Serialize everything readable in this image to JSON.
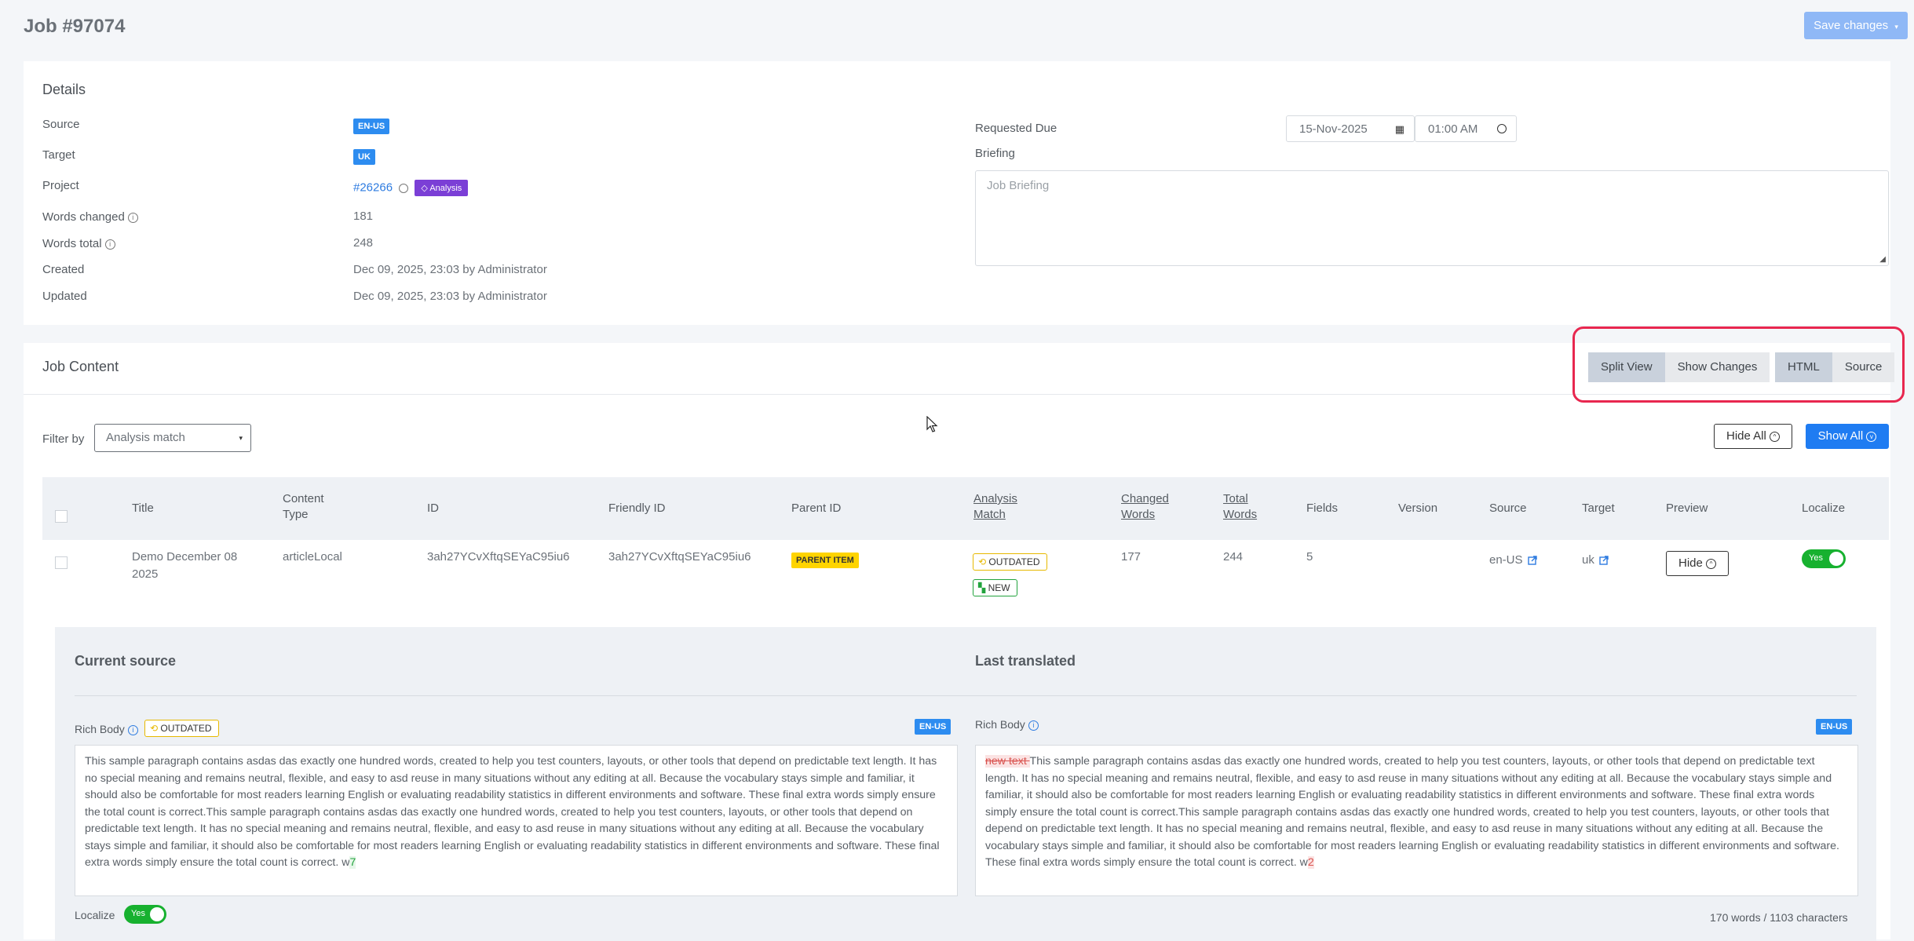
{
  "header": {
    "title": "Job #97074",
    "save_label": "Save changes"
  },
  "details": {
    "title": "Details",
    "labels": {
      "source": "Source",
      "target": "Target",
      "project": "Project",
      "words_changed": "Words changed",
      "words_total": "Words total",
      "created": "Created",
      "updated": "Updated",
      "requested_due": "Requested Due",
      "briefing": "Briefing"
    },
    "source_lang": "EN-US",
    "target_lang": "UK",
    "project_link": "#26266",
    "project_tag": "Analysis",
    "words_changed": "181",
    "words_total": "248",
    "created": "Dec 09, 2025, 23:03 by Administrator",
    "updated": "Dec 09, 2025, 23:03 by Administrator",
    "due_date": "15-Nov-2025",
    "due_time": "01:00 AM",
    "briefing_placeholder": "Job Briefing"
  },
  "content": {
    "title": "Job Content",
    "view_toggle": {
      "split": "Split View",
      "changes": "Show Changes"
    },
    "format_toggle": {
      "html": "HTML",
      "source": "Source"
    },
    "filter_label": "Filter by",
    "filter_value": "Analysis match",
    "hide_all": "Hide All",
    "show_all": "Show All",
    "columns": {
      "title": "Title",
      "content_type_1": "Content",
      "content_type_2": "Type",
      "id": "ID",
      "friendly_id": "Friendly ID",
      "parent_id": "Parent ID",
      "analysis_1": "Analysis",
      "analysis_2": "Match",
      "changed_1": "Changed",
      "changed_2": "Words",
      "total_1": "Total",
      "total_2": "Words",
      "fields": "Fields",
      "version": "Version",
      "source": "Source",
      "target": "Target",
      "preview": "Preview",
      "localize": "Localize"
    },
    "row": {
      "title_1": "Demo December 08",
      "title_2": "2025",
      "content_type": "articleLocal",
      "id": "3ah27YCvXftqSEYaC95iu6",
      "friendly_id": "3ah27YCvXftqSEYaC95iu6",
      "parent_id": "PARENT ITEM",
      "status_outdated": "OUTDATED",
      "status_new": "NEW",
      "changed_words": "177",
      "total_words": "244",
      "fields": "5",
      "source": "en-US",
      "target": "uk",
      "preview": "Hide",
      "localize": "Yes"
    }
  },
  "panel": {
    "current_source": "Current source",
    "last_translated": "Last translated",
    "field_label": "Rich Body",
    "field_status": "OUTDATED",
    "lang": "EN-US",
    "source_text": "This sample paragraph contains asdas das exactly one hundred words, created to help you test counters, layouts, or other tools that depend on predictable text length. It has no special meaning and remains neutral, flexible, and easy to asd reuse in many situations without any editing at all. Because the vocabulary stays simple and familiar, it should also be comfortable for most readers learning English or evaluating readability statistics in different environments and software. These final extra words simply ensure the total count is correct.This sample paragraph contains asdas das exactly one hundred words, created to help you test counters, layouts, or other tools that depend on predictable text length. It has no special meaning and remains neutral, flexible, and easy to asd reuse in many situations without any editing at all. Because the vocabulary stays simple and familiar, it should also be comfortable for most readers learning English or evaluating readability statistics in different environments and software. These final extra words simply ensure the total count is correct. w",
    "source_added": "7",
    "translated_removed": "new text ",
    "translated_text": "This sample paragraph contains asdas das exactly one hundred words, created to help you test counters, layouts, or other tools that depend on predictable text length. It has no special meaning and remains neutral, flexible, and easy to asd reuse in many situations without any editing at all. Because the vocabulary stays simple and familiar, it should also be comfortable for most readers learning English or evaluating readability statistics in different environments and software. These final extra words simply ensure the total count is correct.This sample paragraph contains asdas das exactly one hundred words, created to help you test counters, layouts, or other tools that depend on predictable text length. It has no special meaning and remains neutral, flexible, and easy to asd reuse in many situations without any editing at all. Because the vocabulary stays simple and familiar, it should also be comfortable for most readers learning English or evaluating readability statistics in different environments and software. These final extra words simply ensure the total count is correct. w",
    "translated_changed": "2",
    "localize_label": "Localize",
    "localize_value": "Yes",
    "counts": "170 words / 1103 characters"
  }
}
